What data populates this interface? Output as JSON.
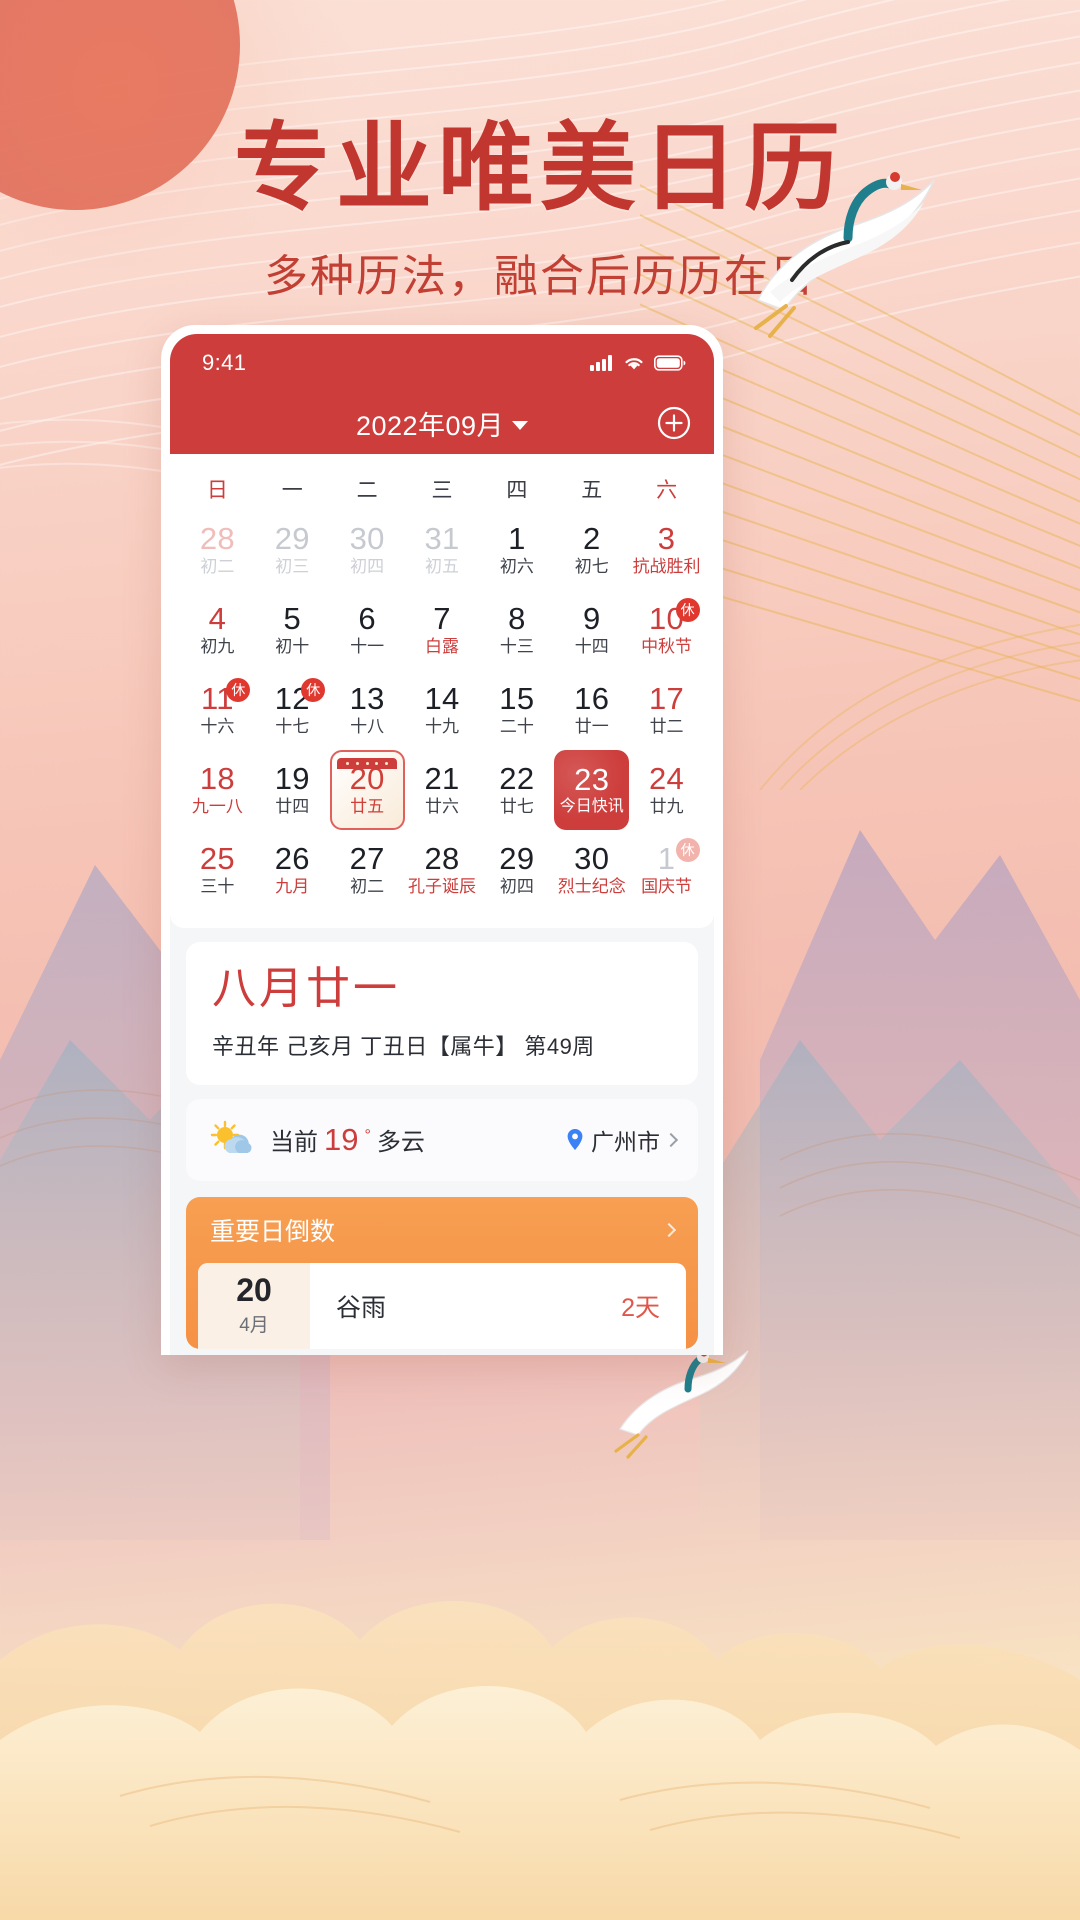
{
  "poster": {
    "headline": "专业唯美日历",
    "subheadline": "多种历法，融合后历历在目",
    "colors": {
      "headline": "#c1362e",
      "accent_red": "#cd3d3b",
      "orange": "#f59145"
    }
  },
  "statusbar": {
    "time": "9:41",
    "icons": [
      "signal-icon",
      "wifi-icon",
      "battery-icon"
    ]
  },
  "navbar": {
    "title": "2022年09月",
    "dropdown_icon": "chevron-down-icon",
    "add_label": "+",
    "add_icon": "plus-circle-icon"
  },
  "calendar": {
    "weekdays": [
      "日",
      "一",
      "二",
      "三",
      "四",
      "五",
      "六"
    ],
    "weeks": [
      [
        {
          "day": "28",
          "lunar": "初二",
          "muted": true,
          "red": true
        },
        {
          "day": "29",
          "lunar": "初三",
          "muted": true
        },
        {
          "day": "30",
          "lunar": "初四",
          "muted": true
        },
        {
          "day": "31",
          "lunar": "初五",
          "muted": true
        },
        {
          "day": "1",
          "lunar": "初六"
        },
        {
          "day": "2",
          "lunar": "初七"
        },
        {
          "day": "3",
          "lunar": "抗战胜利",
          "red": true,
          "lunar_red": true
        }
      ],
      [
        {
          "day": "4",
          "lunar": "初九",
          "red": true
        },
        {
          "day": "5",
          "lunar": "初十"
        },
        {
          "day": "6",
          "lunar": "十一"
        },
        {
          "day": "7",
          "lunar": "白露",
          "lunar_red": true
        },
        {
          "day": "8",
          "lunar": "十三"
        },
        {
          "day": "9",
          "lunar": "十四"
        },
        {
          "day": "10",
          "lunar": "中秋节",
          "red": true,
          "lunar_red": true,
          "badge": "休"
        }
      ],
      [
        {
          "day": "11",
          "lunar": "十六",
          "red": true,
          "badge": "休"
        },
        {
          "day": "12",
          "lunar": "十七",
          "badge": "休"
        },
        {
          "day": "13",
          "lunar": "十八"
        },
        {
          "day": "14",
          "lunar": "十九"
        },
        {
          "day": "15",
          "lunar": "二十"
        },
        {
          "day": "16",
          "lunar": "廿一"
        },
        {
          "day": "17",
          "lunar": "廿二",
          "red": true
        }
      ],
      [
        {
          "day": "18",
          "lunar": "九一八",
          "red": true,
          "lunar_red": true
        },
        {
          "day": "19",
          "lunar": "廿四"
        },
        {
          "day": "20",
          "lunar": "廿五",
          "selected": true
        },
        {
          "day": "21",
          "lunar": "廿六"
        },
        {
          "day": "22",
          "lunar": "廿七"
        },
        {
          "day": "23",
          "lunar": "今日快讯",
          "today": true
        },
        {
          "day": "24",
          "lunar": "廿九",
          "red": true
        }
      ],
      [
        {
          "day": "25",
          "lunar": "三十",
          "red": true
        },
        {
          "day": "26",
          "lunar": "九月",
          "lunar_red": true
        },
        {
          "day": "27",
          "lunar": "初二"
        },
        {
          "day": "28",
          "lunar": "孔子诞辰",
          "lunar_red": true
        },
        {
          "day": "29",
          "lunar": "初四"
        },
        {
          "day": "30",
          "lunar": "烈士纪念",
          "lunar_red": true
        },
        {
          "day": "1",
          "lunar": "国庆节",
          "muted": true,
          "lunar_red": true,
          "badge": "休",
          "badge_muted": true
        }
      ]
    ]
  },
  "lunar_info": {
    "title": "八月廿一",
    "detail": "辛丑年 己亥月 丁丑日【属牛】  第49周"
  },
  "weather": {
    "icon": "sun-cloud-icon",
    "prefix": "当前",
    "temp": "19",
    "degree": "°",
    "condition": "多云",
    "location_icon": "location-pin-icon",
    "location": "广州市",
    "chevron": "chevron-right-icon"
  },
  "countdown": {
    "title": "重要日倒数",
    "chevron": "chevron-right-icon",
    "items": [
      {
        "day": "20",
        "month": "4月",
        "name": "谷雨",
        "left": "2",
        "left_unit": "天"
      }
    ]
  }
}
